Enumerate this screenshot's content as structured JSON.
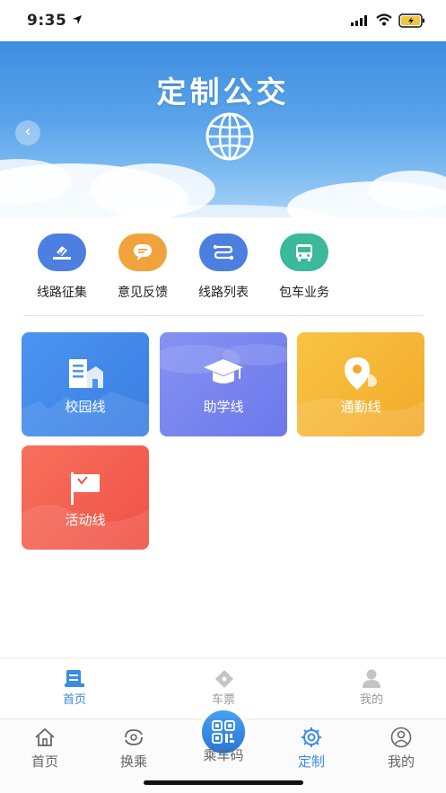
{
  "status_bar": {
    "time": "9:35"
  },
  "banner": {
    "title": "定制公交"
  },
  "quick_actions": [
    {
      "label": "线路征集",
      "icon": "vote-icon",
      "color": "#4b7fe0"
    },
    {
      "label": "意见反馈",
      "icon": "chat-bubble-icon",
      "color": "#f2a23c"
    },
    {
      "label": "线路列表",
      "icon": "route-icon",
      "color": "#4b7fe0"
    },
    {
      "label": "包车业务",
      "icon": "bus-icon",
      "color": "#3cb89a"
    }
  ],
  "route_cards": [
    {
      "label": "校园线",
      "icon": "school-building-icon",
      "color": "#3f86ea"
    },
    {
      "label": "助学线",
      "icon": "graduation-cap-icon",
      "color": "#6f7ff0"
    },
    {
      "label": "通勤线",
      "icon": "location-pin-icon",
      "color": "#f5b333"
    },
    {
      "label": "活动线",
      "icon": "flag-icon",
      "color": "#f25a4e"
    }
  ],
  "inner_tabs": [
    {
      "label": "首页",
      "icon": "home-list-icon",
      "active": true
    },
    {
      "label": "车票",
      "icon": "ticket-icon",
      "active": false
    },
    {
      "label": "我的",
      "icon": "user-icon",
      "active": false
    }
  ],
  "bottom_tabs": [
    {
      "label": "首页",
      "icon": "house-icon",
      "active": false
    },
    {
      "label": "换乘",
      "icon": "transfer-icon",
      "active": false
    },
    {
      "label": "乘车码",
      "icon": "qr-code-icon",
      "active": false
    },
    {
      "label": "定制",
      "icon": "custom-gear-icon",
      "active": true
    },
    {
      "label": "我的",
      "icon": "person-icon",
      "active": false
    }
  ],
  "colors": {
    "accent": "#3a8be6",
    "banner_sky": "#4a96e4"
  }
}
